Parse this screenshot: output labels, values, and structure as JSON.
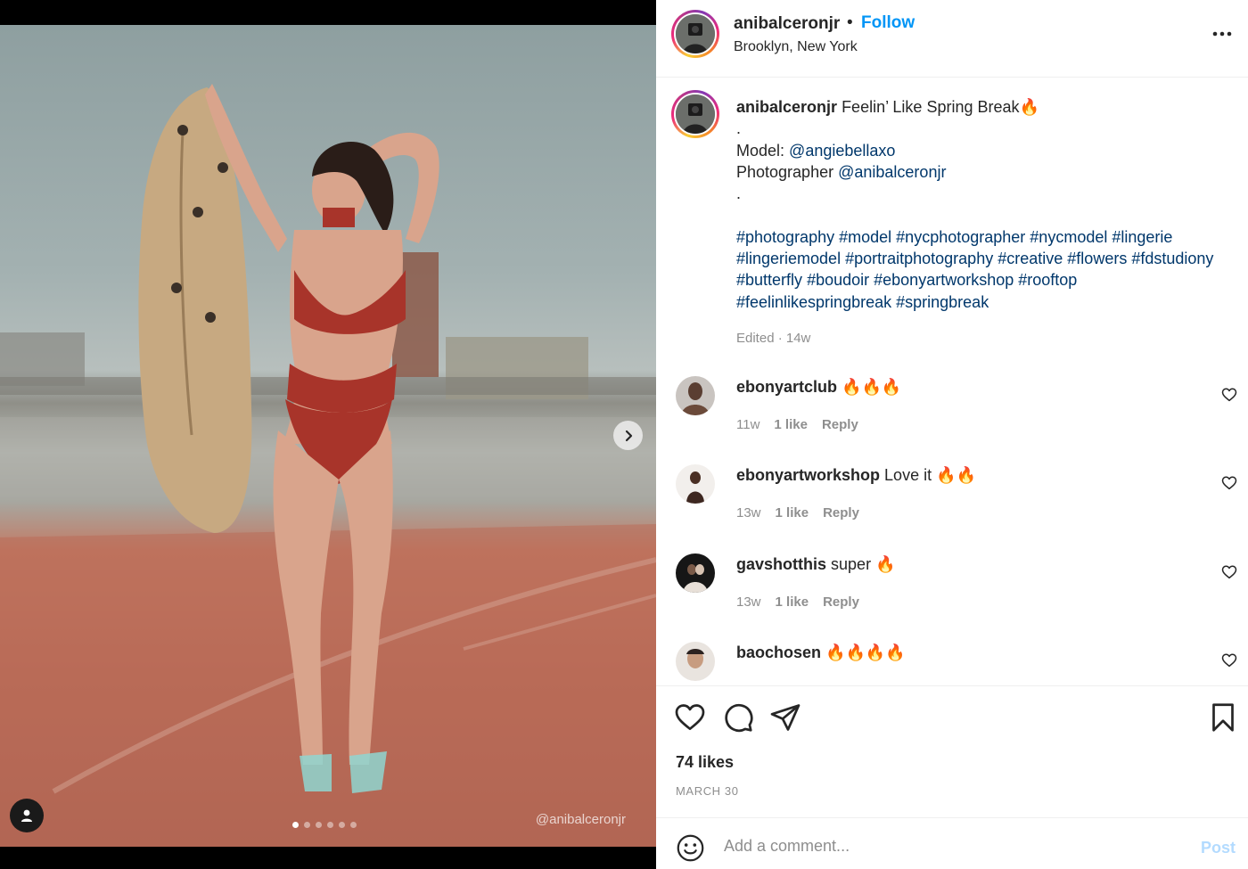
{
  "post": {
    "username": "anibalceronjr",
    "separator": "•",
    "follow_label": "Follow",
    "location": "Brooklyn, New York",
    "more_icon": "more-horizontal-icon"
  },
  "media": {
    "watermark": "@anibalceronjr",
    "slide_count": 6,
    "active_slide": 1,
    "next_icon": "chevron-right-icon",
    "tag_icon": "user-tag-icon"
  },
  "caption": {
    "username": "anibalceronjr",
    "title": "Feelin’ Like Spring Break🔥",
    "dot1": ".",
    "model_label": "Model:",
    "model_mention": "@angiebellaxo",
    "photographer_label": "Photographer",
    "photographer_mention": "@anibalceronjr",
    "dot2": ".",
    "hashtags": [
      "#photography",
      "#model",
      "#nycphotographer",
      "#nycmodel",
      "#lingerie",
      "#lingeriemodel",
      "#portraitphotography",
      "#creative",
      "#flowers",
      "#fdstudiony",
      "#butterfly",
      "#boudoir",
      "#ebonyartworkshop",
      "#rooftop",
      "#feelinlikespringbreak",
      "#springbreak"
    ],
    "edited": "Edited · 14w"
  },
  "comments": [
    {
      "username": "ebonyartclub",
      "text": "🔥🔥🔥",
      "age": "11w",
      "likes": "1 like",
      "reply": "Reply"
    },
    {
      "username": "ebonyartworkshop",
      "text": "Love it 🔥🔥",
      "age": "13w",
      "likes": "1 like",
      "reply": "Reply"
    },
    {
      "username": "gavshotthis",
      "text": "super 🔥",
      "age": "13w",
      "likes": "1 like",
      "reply": "Reply"
    },
    {
      "username": "baochosen",
      "text": "🔥🔥🔥🔥",
      "age": "",
      "likes": "",
      "reply": ""
    }
  ],
  "actions": {
    "likes": "74 likes",
    "date": "MARCH 30"
  },
  "add_comment": {
    "placeholder": "Add a comment...",
    "post_label": "Post"
  },
  "colors": {
    "accent": "#0095f6",
    "link": "#00376b",
    "muted": "#8e8e8e",
    "post_disabled": "#b3dbff"
  }
}
